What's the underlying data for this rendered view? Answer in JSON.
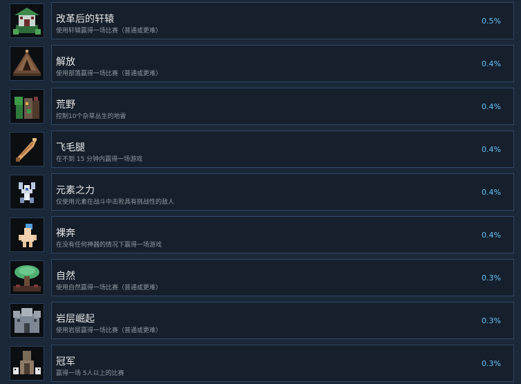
{
  "achievements": [
    {
      "title": "改革后的轩辕",
      "description": "使用轩辕赢得一场比赛（普通或更难）",
      "percent": "0.5%",
      "icon": "temple-icon"
    },
    {
      "title": "解放",
      "description": "使用部落赢得一场比赛（普通或更难）",
      "percent": "0.4%",
      "icon": "tent-icon"
    },
    {
      "title": "荒野",
      "description": "控制10个杂草丛生的地雷",
      "percent": "0.4%",
      "icon": "overgrown-mine-icon"
    },
    {
      "title": "飞毛腿",
      "description": "在不到 15 分钟内赢得一场游戏",
      "percent": "0.4%",
      "icon": "horn-icon"
    },
    {
      "title": "元素之力",
      "description": "仅使用元素在战斗中击败具有挑战性的敌人",
      "percent": "0.4%",
      "icon": "elemental-icon"
    },
    {
      "title": "裸奔",
      "description": "在没有任何神器的情况下赢得一场游戏",
      "percent": "0.4%",
      "icon": "naked-hero-icon"
    },
    {
      "title": "自然",
      "description": "使用自然赢得一场比赛（普通或更难）",
      "percent": "0.3%",
      "icon": "tree-icon"
    },
    {
      "title": "岩层崛起",
      "description": "使用岩层赢得一场比赛（普通或更难）",
      "percent": "0.3%",
      "icon": "fortress-icon"
    },
    {
      "title": "冠军",
      "description": "赢得一场 5人以上的比赛",
      "percent": "0.3%",
      "icon": "champion-icon"
    }
  ],
  "colors": {
    "background": "#1b2838",
    "card": "#16202d",
    "border": "#2f4a63",
    "percent": "#67c1f5"
  }
}
